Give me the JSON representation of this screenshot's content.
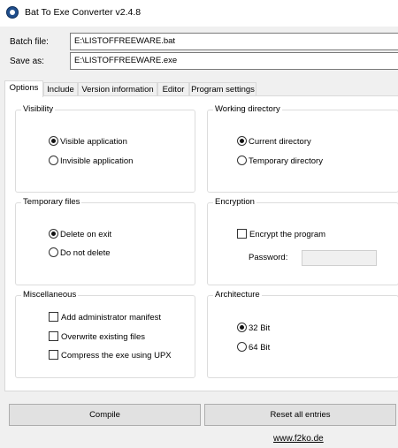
{
  "window": {
    "title": "Bat To Exe Converter v2.4.8",
    "icon": "app-icon"
  },
  "fields": {
    "batch_label": "Batch file:",
    "batch_value": "E:\\LISTOFFREEWARE.bat",
    "saveas_label": "Save as:",
    "saveas_value": "E:\\LISTOFFREEWARE.exe"
  },
  "tabs": [
    "Options",
    "Include",
    "Version information",
    "Editor",
    "Program settings"
  ],
  "active_tab": "Options",
  "options": {
    "visibility": {
      "title": "Visibility",
      "visible": "Visible application",
      "invisible": "Invisible application",
      "selected": "visible"
    },
    "working_directory": {
      "title": "Working directory",
      "current": "Current directory",
      "temporary": "Temporary directory",
      "selected": "current"
    },
    "temporary_files": {
      "title": "Temporary files",
      "delete": "Delete on exit",
      "no_delete": "Do not delete",
      "selected": "delete"
    },
    "encryption": {
      "title": "Encryption",
      "encrypt": "Encrypt the program",
      "encrypt_checked": false,
      "password_label": "Password:",
      "password_value": ""
    },
    "miscellaneous": {
      "title": "Miscellaneous",
      "admin": "Add administrator manifest",
      "overwrite": "Overwrite existing files",
      "upx": "Compress the exe using UPX"
    },
    "architecture": {
      "title": "Architecture",
      "bit32": "32 Bit",
      "bit64": "64 Bit",
      "selected": "32"
    }
  },
  "buttons": {
    "compile": "Compile",
    "reset": "Reset all entries"
  },
  "footer": {
    "link": "www.f2ko.de"
  }
}
